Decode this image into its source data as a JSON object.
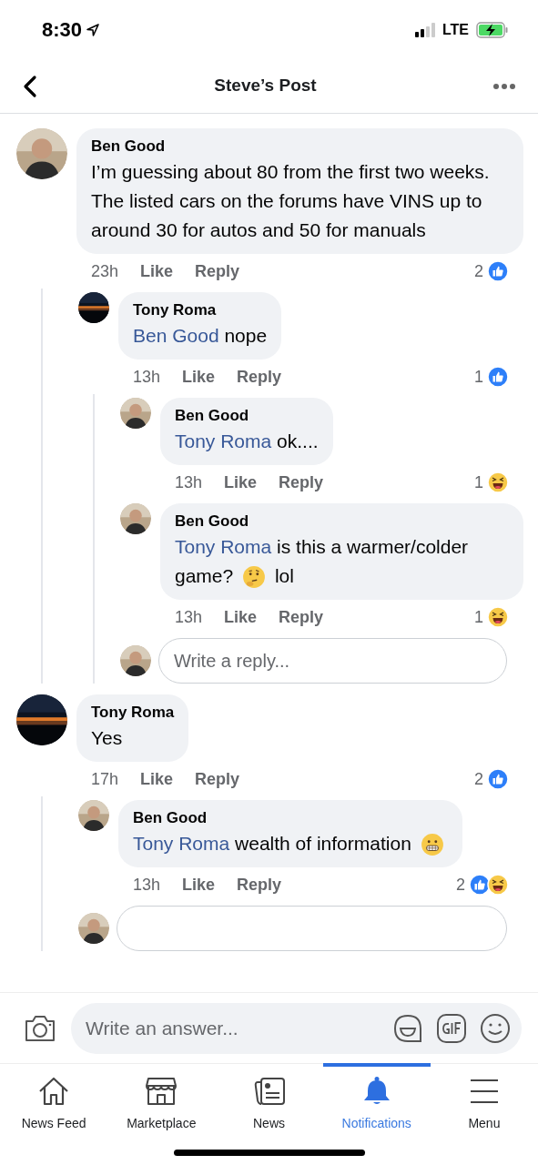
{
  "status_bar": {
    "time": "8:30",
    "network": "LTE"
  },
  "nav": {
    "title": "Steve’s Post"
  },
  "comments": [
    {
      "kind": "comment",
      "author": "Ben Good",
      "avatar": {
        "kind": "person"
      },
      "body": [
        {
          "kind": "text",
          "text": "I’m guessing about 80 from the first two weeks. The listed cars on the forums have VINS up to around 30 for autos and 50 for manuals"
        }
      ],
      "time": "23h",
      "like": "Like",
      "reply": "Reply",
      "reaction_count": "2",
      "reactions": [
        {
          "kind": "like"
        }
      ],
      "children": [
        {
          "kind": "comment",
          "author": "Tony Roma",
          "avatar": {
            "kind": "sunset"
          },
          "body": [
            {
              "kind": "mention",
              "text": "Ben Good"
            },
            {
              "kind": "text",
              "text": " nope"
            }
          ],
          "time": "13h",
          "like": "Like",
          "reply": "Reply",
          "reaction_count": "1",
          "reactions": [
            {
              "kind": "like"
            }
          ],
          "children": [
            {
              "kind": "comment",
              "author": "Ben Good",
              "avatar": {
                "kind": "person"
              },
              "body": [
                {
                  "kind": "mention",
                  "text": "Tony Roma"
                },
                {
                  "kind": "text",
                  "text": " ok...."
                }
              ],
              "time": "13h",
              "like": "Like",
              "reply": "Reply",
              "reaction_count": "1",
              "reactions": [
                {
                  "kind": "haha"
                }
              ]
            },
            {
              "kind": "comment",
              "author": "Ben Good",
              "avatar": {
                "kind": "person"
              },
              "body": [
                {
                  "kind": "mention",
                  "text": "Tony Roma"
                },
                {
                  "kind": "text",
                  "text": " is this a warmer/colder game? "
                },
                {
                  "kind": "thinking"
                },
                {
                  "kind": "text",
                  "text": " lol"
                }
              ],
              "time": "13h",
              "like": "Like",
              "reply": "Reply",
              "reaction_count": "1",
              "reactions": [
                {
                  "kind": "haha"
                }
              ]
            },
            {
              "kind": "reply_field",
              "avatar": {
                "kind": "person"
              },
              "placeholder": "Write a reply..."
            }
          ]
        }
      ]
    },
    {
      "kind": "comment",
      "author": "Tony Roma",
      "avatar": {
        "kind": "sunset"
      },
      "body": [
        {
          "kind": "text",
          "text": "Yes"
        }
      ],
      "time": "17h",
      "like": "Like",
      "reply": "Reply",
      "reaction_count": "2",
      "reactions": [
        {
          "kind": "like"
        }
      ],
      "children": [
        {
          "kind": "comment",
          "author": "Ben Good",
          "avatar": {
            "kind": "person"
          },
          "body": [
            {
              "kind": "mention",
              "text": "Tony Roma"
            },
            {
              "kind": "text",
              "text": " wealth of information "
            },
            {
              "kind": "grimace"
            }
          ],
          "time": "13h",
          "like": "Like",
          "reply": "Reply",
          "reaction_count": "2",
          "reactions": [
            {
              "kind": "like"
            },
            {
              "kind": "haha"
            }
          ]
        },
        {
          "kind": "reply_field",
          "avatar": {
            "kind": "person"
          }
        }
      ]
    }
  ],
  "composer": {
    "placeholder": "Write an answer..."
  },
  "tabs": [
    {
      "label": "News Feed",
      "selected": false
    },
    {
      "label": "Marketplace",
      "selected": false
    },
    {
      "label": "News",
      "selected": false
    },
    {
      "label": "Notifications",
      "selected": true
    },
    {
      "label": "Menu",
      "selected": false
    }
  ]
}
